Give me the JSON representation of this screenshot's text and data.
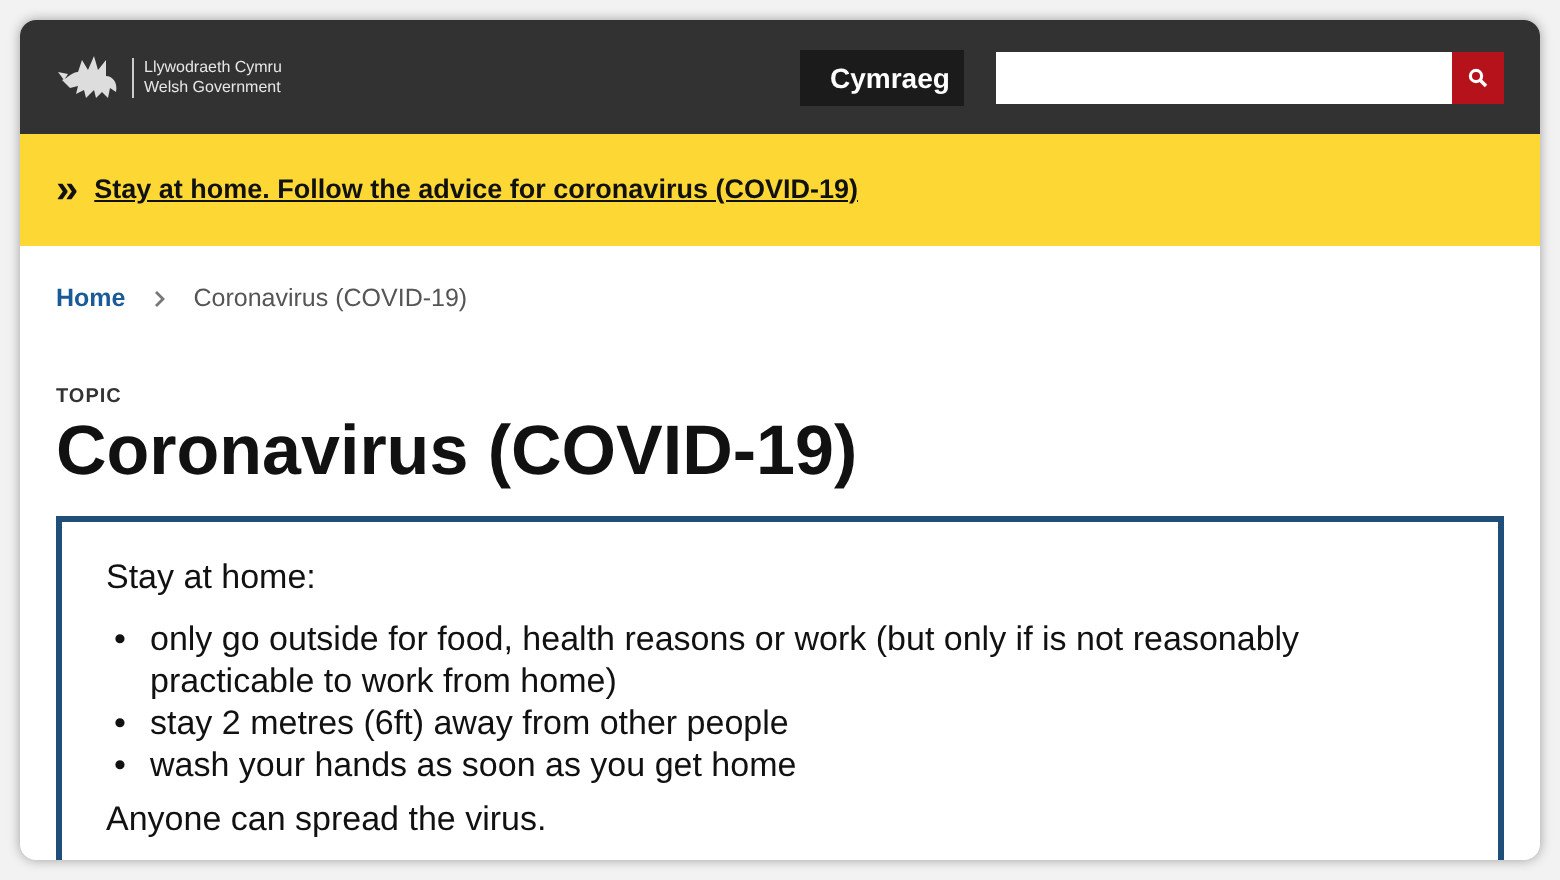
{
  "header": {
    "logo_lines": [
      "Llywodraeth Cymru",
      "Welsh Government"
    ],
    "language_button": "Cymraeg"
  },
  "banner": {
    "icon": "»",
    "link": "Stay at home. Follow the advice for coronavirus (COVID-19)"
  },
  "breadcrumb": [
    {
      "label": "Home",
      "link": true
    },
    {
      "label": "Coronavirus (COVID-19)",
      "link": false
    }
  ],
  "topic_label": "TOPIC",
  "title": "Coronavirus (COVID-19)",
  "notice": {
    "intro": "Stay at home:",
    "bullet_mark": "•",
    "bullets": [
      "only go outside for food, health reasons or work (but only if is not reasonably practicable to work from home)",
      "stay 2 metres (6ft) away from other people",
      "wash your hands as soon as you get home"
    ],
    "outro": "Anyone can spread the virus."
  }
}
